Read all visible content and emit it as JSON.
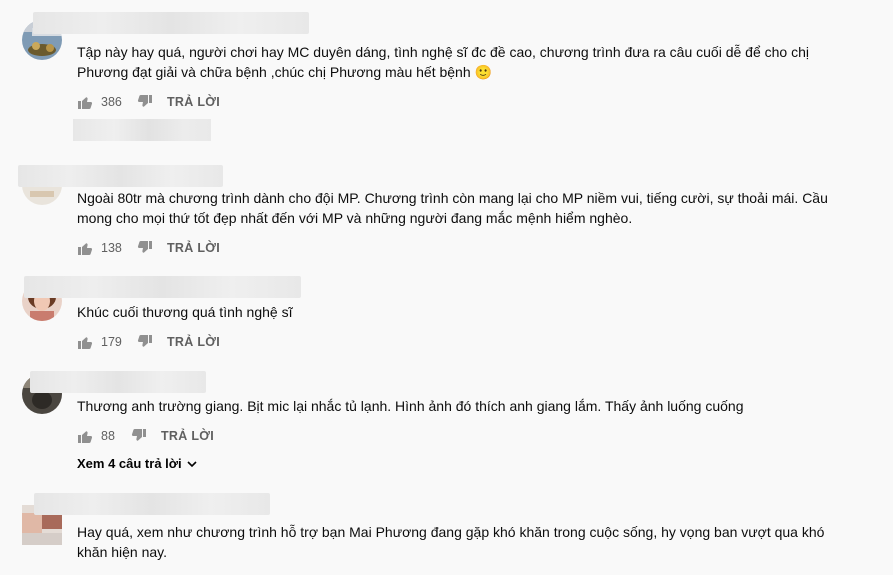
{
  "comments": [
    {
      "text": "Tập này hay quá, người chơi hay MC duyên dáng, tình nghệ sĩ đc đề cao, chương trình đưa ra câu cuối dễ để cho chị Phương đạt giải và chữa bệnh ,chúc chị Phương màu hết bệnh 🙂",
      "likes": "386",
      "reply_label": "TRẢ LỜI"
    },
    {
      "text": "Ngoài 80tr mà chương trình dành cho đội MP. Chương trình còn mang lại cho MP niềm vui, tiếng cười, sự thoải mái. Cầu mong cho mọi thứ tốt đẹp nhất đến với MP và những người đang mắc mệnh hiểm nghèo.",
      "likes": "138",
      "reply_label": "TRẢ LỜI"
    },
    {
      "text": "Khúc cuối thương quá tình nghệ sĩ",
      "likes": "179",
      "reply_label": "TRẢ LỜI"
    },
    {
      "text": "Thương anh trường giang. Bịt mic lại nhắc tủ lạnh.  Hình ảnh đó thích anh giang lắm. Thấy ảnh luống cuống",
      "likes": "88",
      "reply_label": "TRẢ LỜI",
      "view_replies": "Xem 4 câu trả lời"
    },
    {
      "text": "Hay quá, xem như chương trình hỗ trợ bạn Mai Phương đang gặp khó khăn trong cuộc sống, hy vọng ban  vượt qua khó khăn hiện nay."
    }
  ],
  "icons": {
    "like": "thumbs-up-icon",
    "dislike": "thumbs-down-icon",
    "expand": "chevron-down-icon"
  },
  "colors": {
    "background": "#f9f9f9",
    "text": "#0d0d0d",
    "secondary": "#606060"
  }
}
